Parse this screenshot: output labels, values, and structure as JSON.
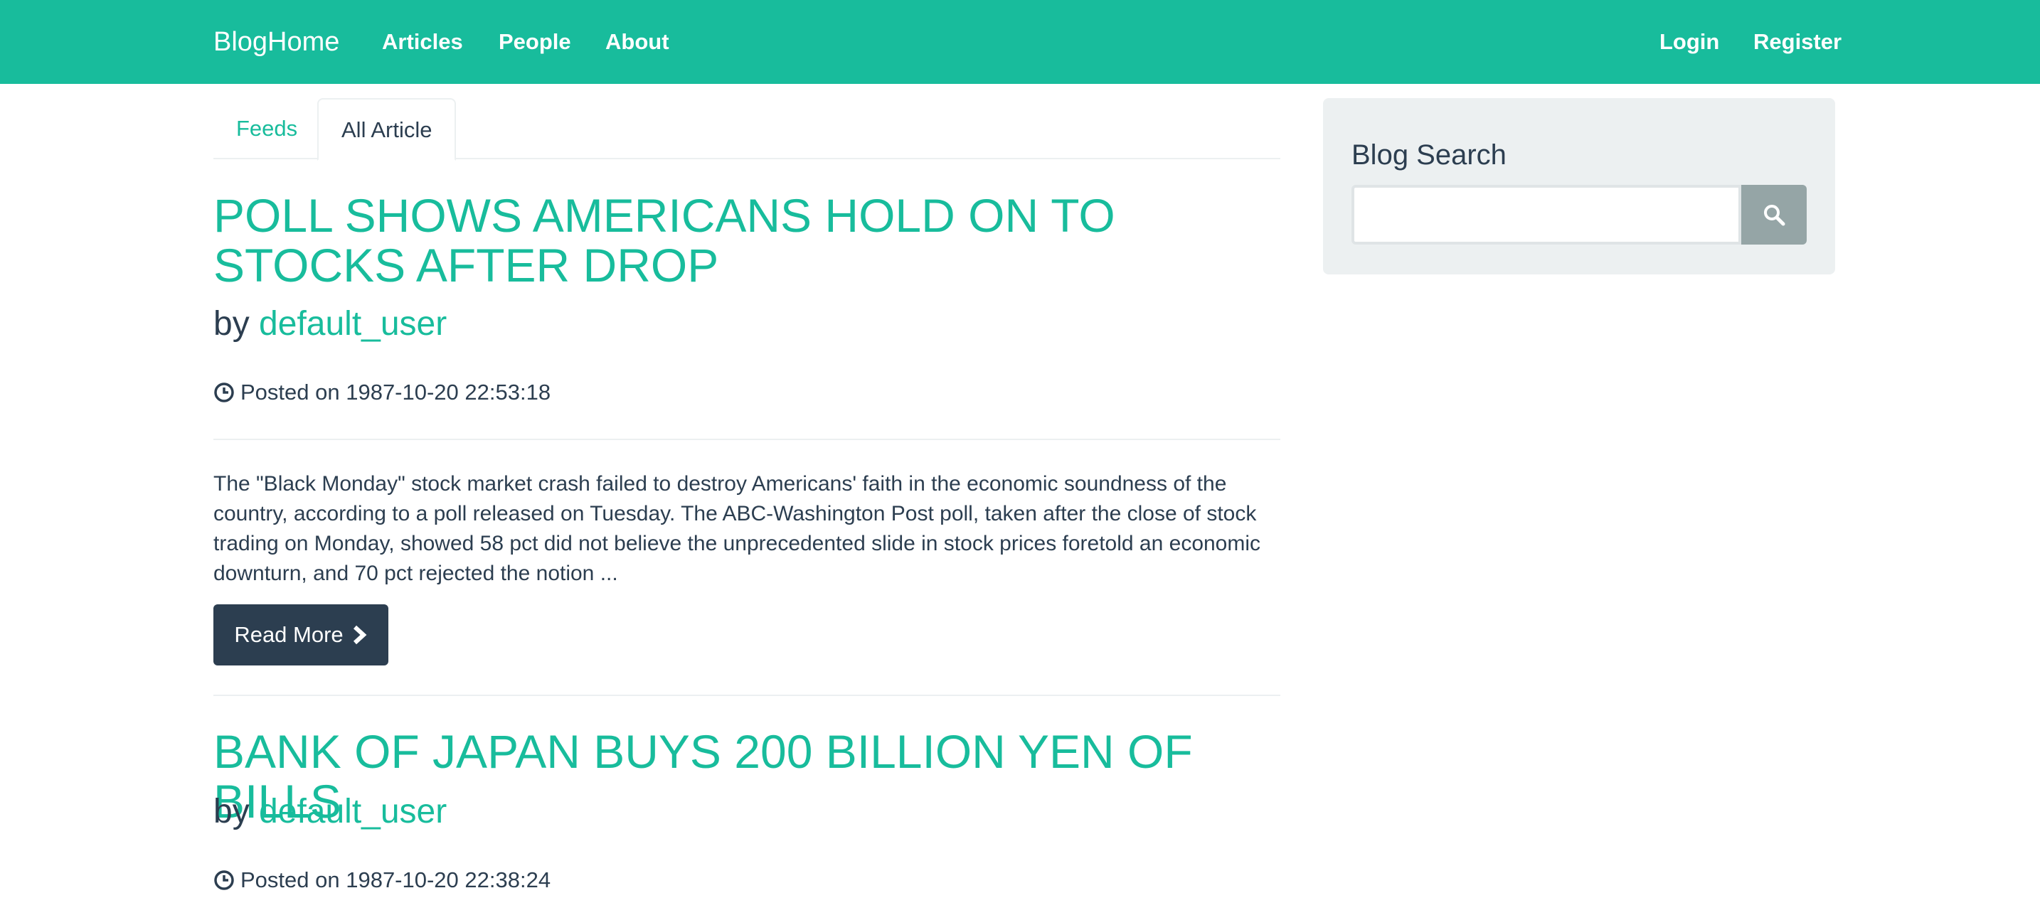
{
  "navbar": {
    "brand": "BlogHome",
    "links": [
      "Articles",
      "People",
      "About"
    ],
    "auth": [
      "Login",
      "Register"
    ]
  },
  "tabs": [
    {
      "label": "Feeds",
      "active": false
    },
    {
      "label": "All Article",
      "active": true
    }
  ],
  "articles": [
    {
      "title": "POLL SHOWS AMERICANS HOLD ON TO STOCKS AFTER DROP",
      "by_label": "by",
      "author": "default_user",
      "posted": "Posted on 1987-10-20 22:53:18",
      "excerpt": "The \"Black Monday\" stock market crash failed to destroy Americans' faith in the economic soundness of the country, according to a poll released on Tuesday. The ABC-Washington Post poll, taken after the close of stock trading on Monday, showed 58 pct did not believe the unprecedented slide in stock prices foretold an economic downturn, and 70 pct rejected the notion ...",
      "read_more": "Read More"
    },
    {
      "title": "BANK OF JAPAN BUYS 200 BILLION YEN OF BILLS",
      "by_label": "by",
      "author": "default_user",
      "posted": "Posted on 1987-10-20 22:38:24"
    }
  ],
  "sidebar": {
    "title": "Blog Search",
    "search_value": ""
  },
  "colors": {
    "primary": "#18bc9c",
    "dark": "#2c3e50",
    "light": "#ecf0f1",
    "button_gray": "#95a5a6"
  }
}
